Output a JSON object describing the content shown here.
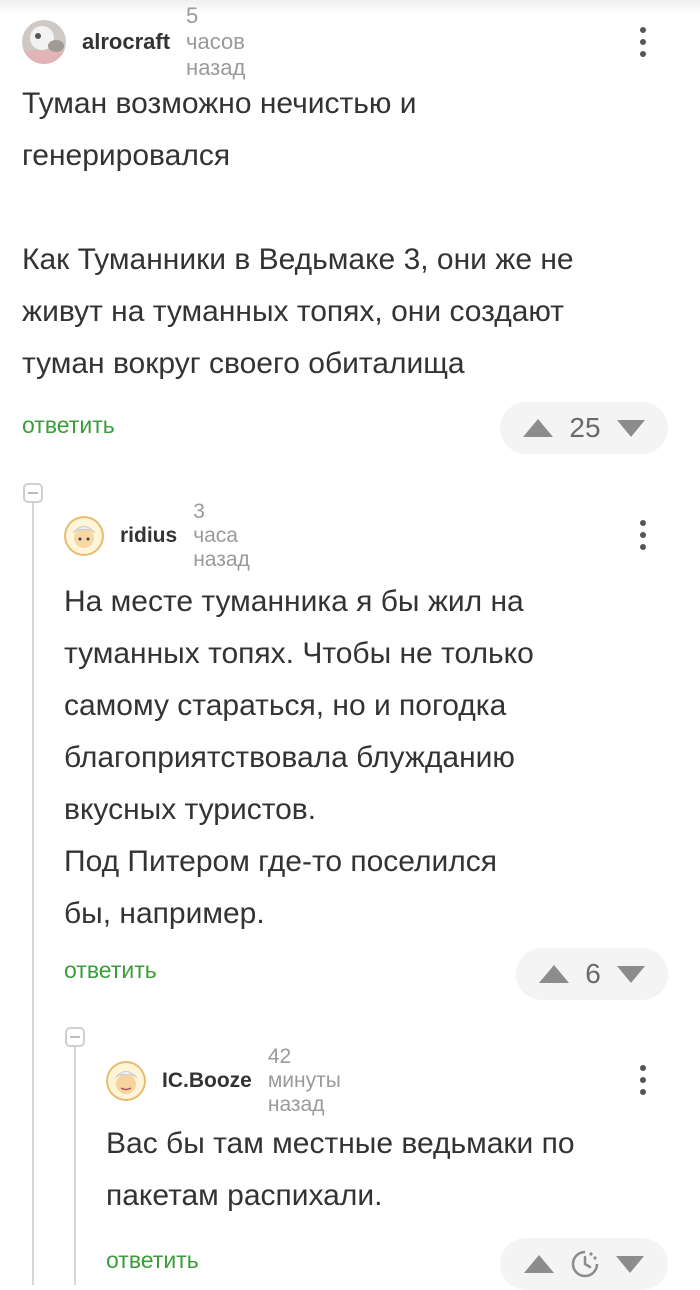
{
  "comments": [
    {
      "author": "alrocraft",
      "time": "5 часов назад",
      "text": "Туман возможно нечистью и\nгенерировался\n\nКак Туманники в Ведьмаке 3, они же не\nживут на туманных топях, они создают\nтуман вокруг своего обиталища",
      "reply_label": "ответить",
      "rating": "25"
    },
    {
      "author": "ridius",
      "time": "3 часа назад",
      "text": "На месте туманника я бы жил на\nтуманных топях. Чтобы не только\nсамому стараться, но и погодка\nблагоприятствовала блужданию\nвкусных туристов.\nПод Питером где-то поселился\nбы, например.",
      "reply_label": "ответить",
      "rating": "6"
    },
    {
      "author": "IC.Booze",
      "time": "42 минуты назад",
      "text": "Вас бы там местные ведьмаки по\nпакетам распихали.",
      "reply_label": "ответить",
      "rating_icon": "clock-pending-icon"
    }
  ]
}
